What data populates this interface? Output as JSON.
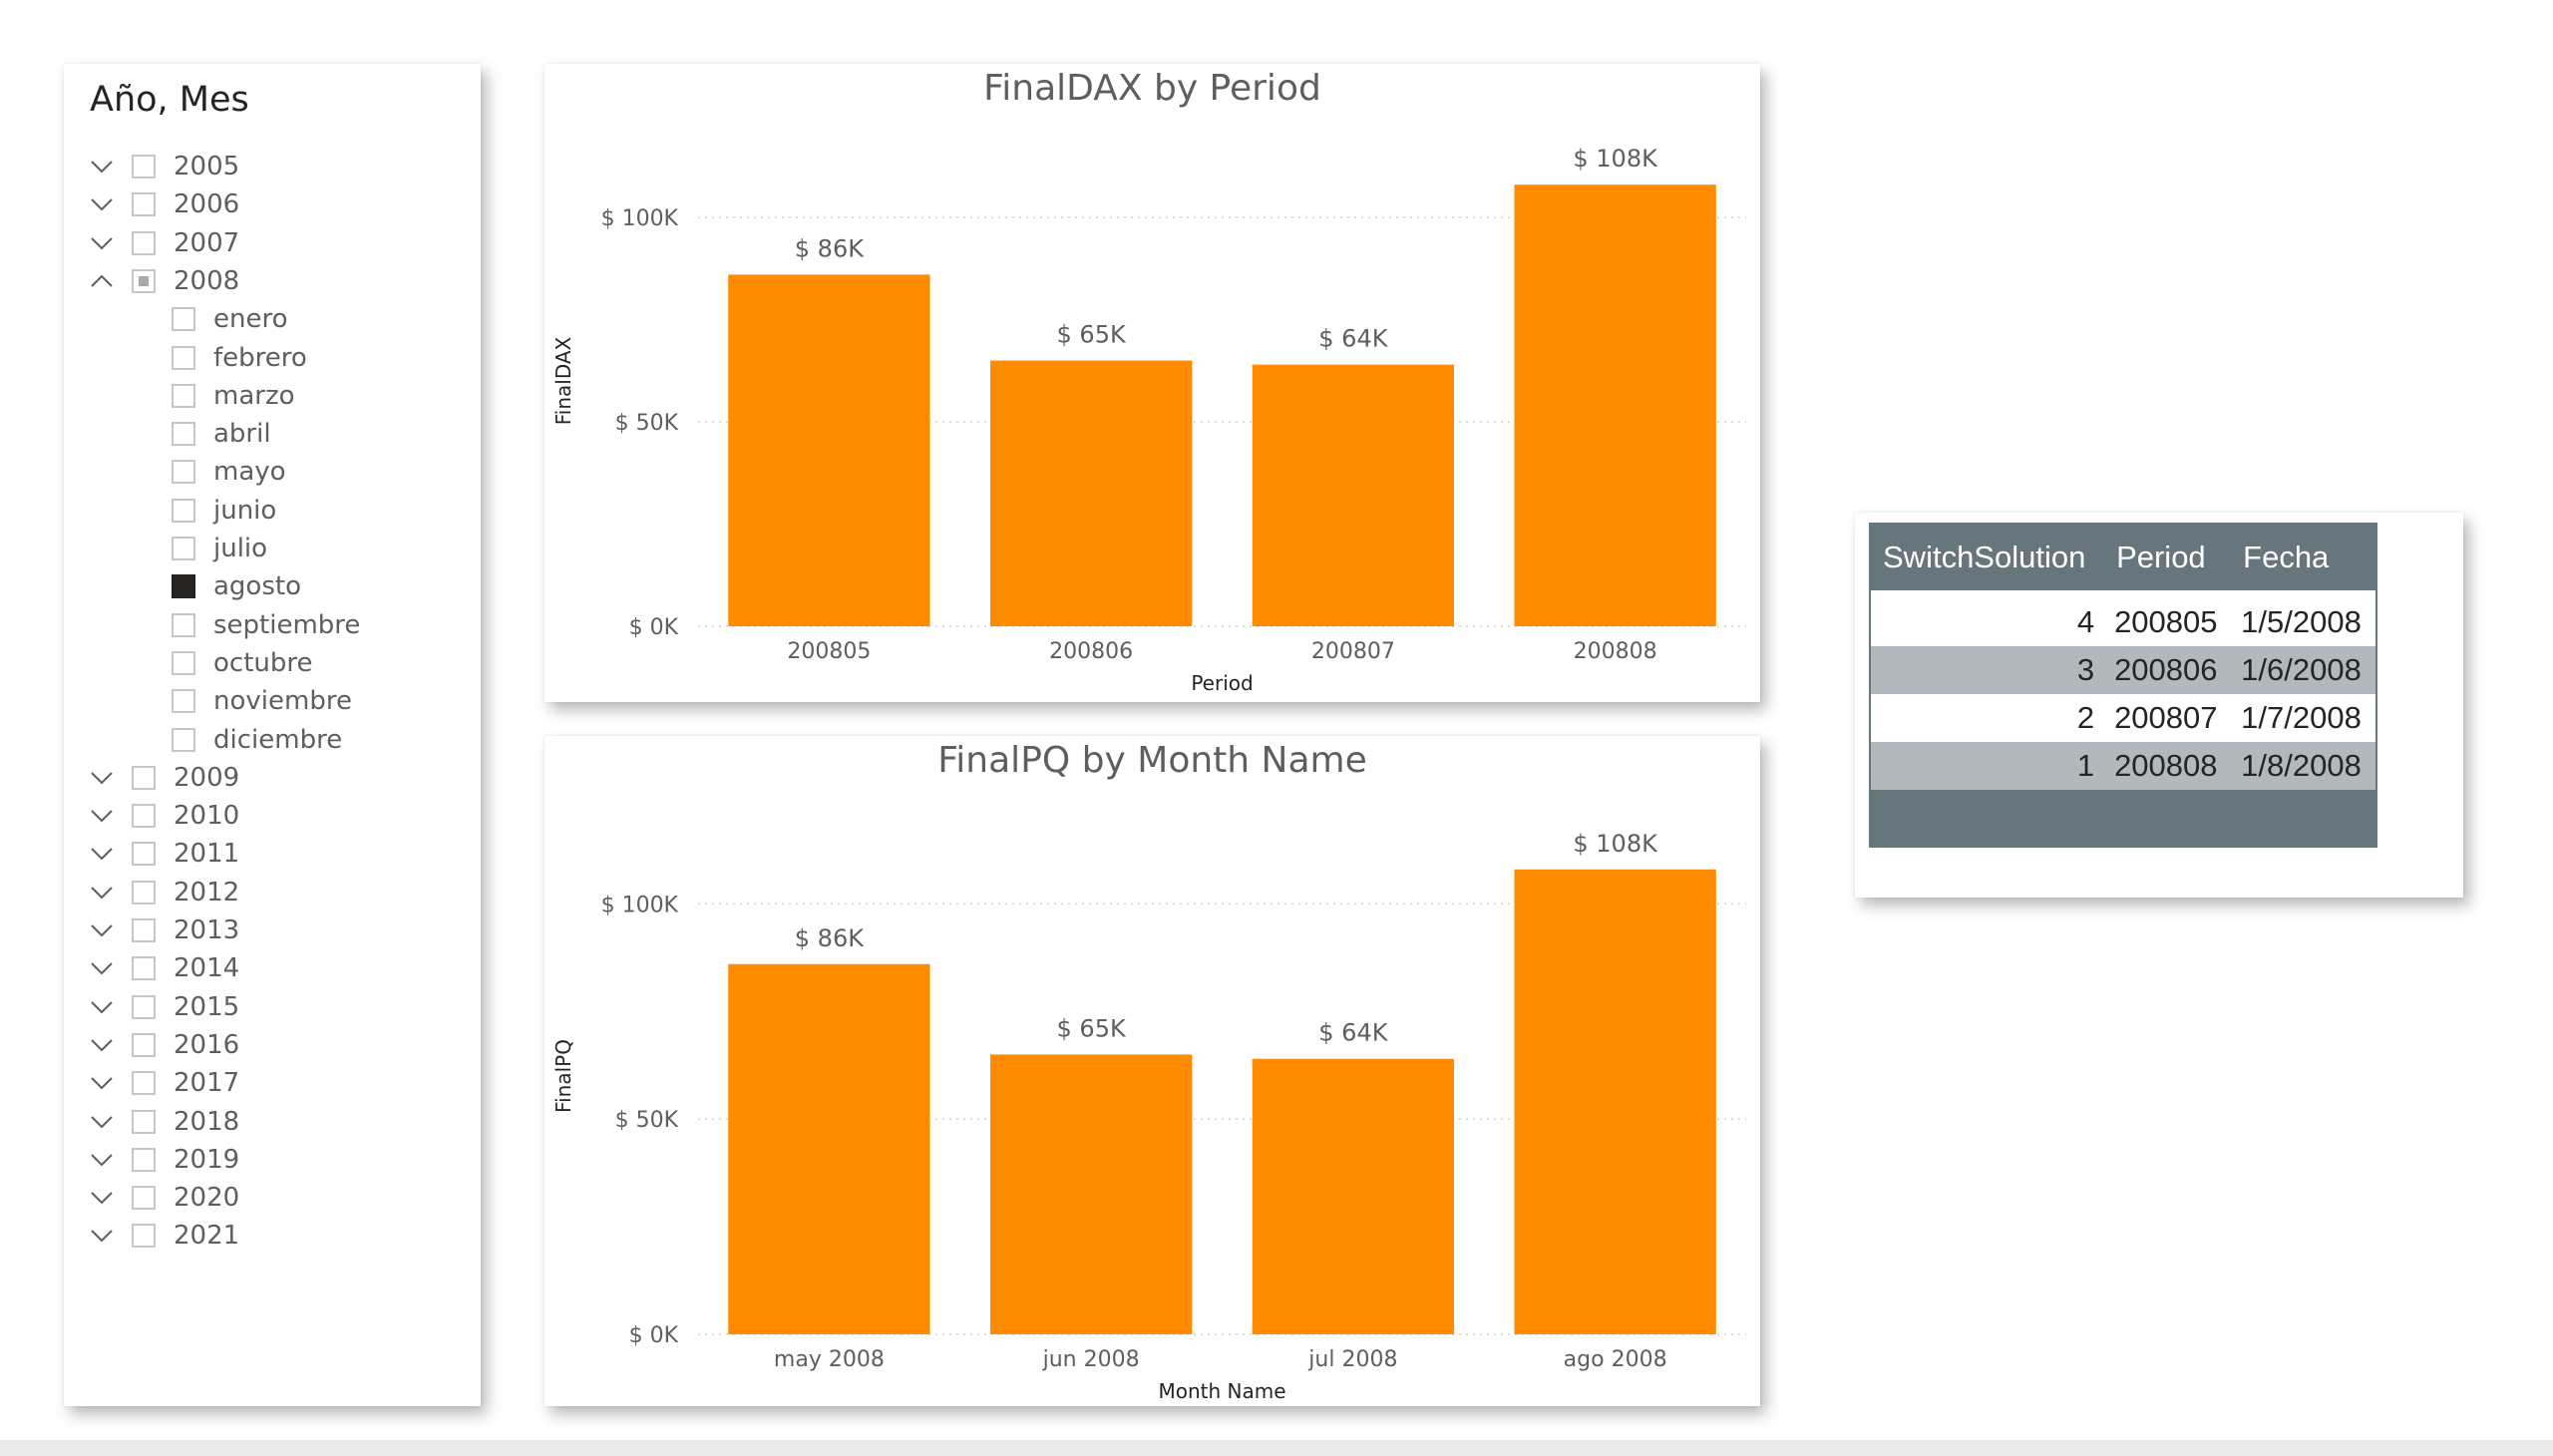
{
  "slicer": {
    "title": "Año, Mes",
    "items": [
      {
        "label": "2005",
        "level": 0,
        "expanded": false,
        "state": "unchecked"
      },
      {
        "label": "2006",
        "level": 0,
        "expanded": false,
        "state": "unchecked"
      },
      {
        "label": "2007",
        "level": 0,
        "expanded": false,
        "state": "unchecked"
      },
      {
        "label": "2008",
        "level": 0,
        "expanded": true,
        "state": "partial"
      },
      {
        "label": "enero",
        "level": 1,
        "state": "unchecked"
      },
      {
        "label": "febrero",
        "level": 1,
        "state": "unchecked"
      },
      {
        "label": "marzo",
        "level": 1,
        "state": "unchecked"
      },
      {
        "label": "abril",
        "level": 1,
        "state": "unchecked"
      },
      {
        "label": "mayo",
        "level": 1,
        "state": "unchecked"
      },
      {
        "label": "junio",
        "level": 1,
        "state": "unchecked"
      },
      {
        "label": "julio",
        "level": 1,
        "state": "unchecked"
      },
      {
        "label": "agosto",
        "level": 1,
        "state": "checked"
      },
      {
        "label": "septiembre",
        "level": 1,
        "state": "unchecked"
      },
      {
        "label": "octubre",
        "level": 1,
        "state": "unchecked"
      },
      {
        "label": "noviembre",
        "level": 1,
        "state": "unchecked"
      },
      {
        "label": "diciembre",
        "level": 1,
        "state": "unchecked"
      },
      {
        "label": "2009",
        "level": 0,
        "expanded": false,
        "state": "unchecked"
      },
      {
        "label": "2010",
        "level": 0,
        "expanded": false,
        "state": "unchecked"
      },
      {
        "label": "2011",
        "level": 0,
        "expanded": false,
        "state": "unchecked"
      },
      {
        "label": "2012",
        "level": 0,
        "expanded": false,
        "state": "unchecked"
      },
      {
        "label": "2013",
        "level": 0,
        "expanded": false,
        "state": "unchecked"
      },
      {
        "label": "2014",
        "level": 0,
        "expanded": false,
        "state": "unchecked"
      },
      {
        "label": "2015",
        "level": 0,
        "expanded": false,
        "state": "unchecked"
      },
      {
        "label": "2016",
        "level": 0,
        "expanded": false,
        "state": "unchecked"
      },
      {
        "label": "2017",
        "level": 0,
        "expanded": false,
        "state": "unchecked"
      },
      {
        "label": "2018",
        "level": 0,
        "expanded": false,
        "state": "unchecked"
      },
      {
        "label": "2019",
        "level": 0,
        "expanded": false,
        "state": "unchecked"
      },
      {
        "label": "2020",
        "level": 0,
        "expanded": false,
        "state": "unchecked"
      },
      {
        "label": "2021",
        "level": 0,
        "expanded": false,
        "state": "unchecked"
      }
    ]
  },
  "colors": {
    "bar": "#ff8c00",
    "table_header": "#67767c",
    "table_alt_row": "#b2b9bd"
  },
  "chart_data": [
    {
      "type": "bar",
      "title": "FinalDAX by Period",
      "xlabel": "Period",
      "ylabel": "FinalDAX",
      "categories": [
        "200805",
        "200806",
        "200807",
        "200808"
      ],
      "values": [
        86,
        65,
        64,
        108
      ],
      "data_labels": [
        "$ 86K",
        "$ 65K",
        "$ 64K",
        "$ 108K"
      ],
      "ylim": [
        0,
        120
      ],
      "yticks": [
        0,
        50,
        100
      ],
      "ytick_labels": [
        "$ 0K",
        "$ 50K",
        "$ 100K"
      ],
      "grid": true
    },
    {
      "type": "bar",
      "title": "FinalPQ by Month Name",
      "xlabel": "Month Name",
      "ylabel": "FinalPQ",
      "categories": [
        "may 2008",
        "jun 2008",
        "jul 2008",
        "ago 2008"
      ],
      "values": [
        86,
        65,
        64,
        108
      ],
      "data_labels": [
        "$ 86K",
        "$ 65K",
        "$ 64K",
        "$ 108K"
      ],
      "ylim": [
        0,
        120
      ],
      "yticks": [
        0,
        50,
        100
      ],
      "ytick_labels": [
        "$ 0K",
        "$ 50K",
        "$ 100K"
      ],
      "grid": true
    }
  ],
  "table": {
    "headers": [
      "SwitchSolution",
      "Period",
      "Fecha"
    ],
    "rows": [
      [
        "4",
        "200805",
        "1/5/2008"
      ],
      [
        "3",
        "200806",
        "1/6/2008"
      ],
      [
        "2",
        "200807",
        "1/7/2008"
      ],
      [
        "1",
        "200808",
        "1/8/2008"
      ]
    ]
  }
}
